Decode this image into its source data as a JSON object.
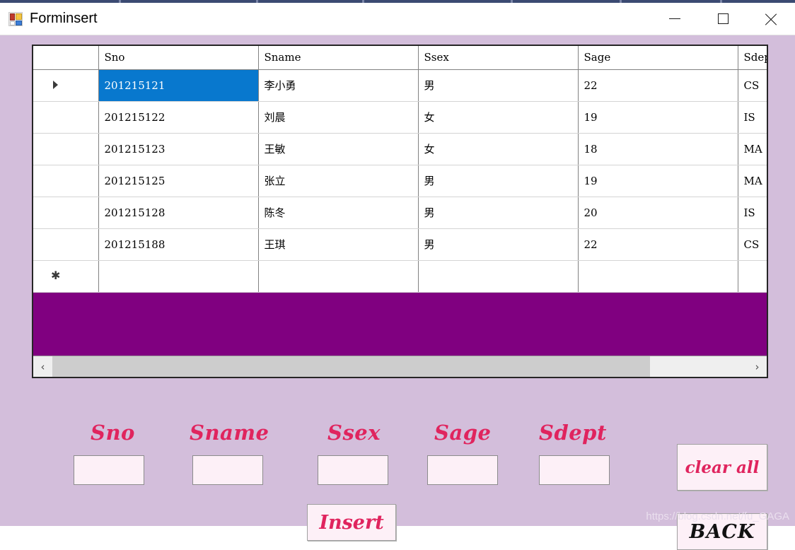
{
  "window": {
    "title": "Forminsert",
    "icon": "winforms-app-icon",
    "controls": {
      "minimize": "minimize-button",
      "maximize": "maximize-button",
      "close": "close-button"
    }
  },
  "grid": {
    "row_header_label": "",
    "columns": [
      "Sno",
      "Sname",
      "Ssex",
      "Sage",
      "Sdep"
    ],
    "rows": [
      {
        "marker": "▶",
        "sno": "201215121",
        "sname": "李小勇",
        "ssex": "男",
        "sage": "22",
        "sdept": "CS",
        "selected": true
      },
      {
        "marker": "",
        "sno": "201215122",
        "sname": "刘晨",
        "ssex": "女",
        "sage": "19",
        "sdept": "IS",
        "selected": false
      },
      {
        "marker": "",
        "sno": "201215123",
        "sname": "王敏",
        "ssex": "女",
        "sage": "18",
        "sdept": "MA",
        "selected": false
      },
      {
        "marker": "",
        "sno": "201215125",
        "sname": "张立",
        "ssex": "男",
        "sage": "19",
        "sdept": "MA",
        "selected": false
      },
      {
        "marker": "",
        "sno": "201215128",
        "sname": "陈冬",
        "ssex": "男",
        "sage": "20",
        "sdept": "IS",
        "selected": false
      },
      {
        "marker": "",
        "sno": "201215188",
        "sname": "王琪",
        "ssex": "男",
        "sage": "22",
        "sdept": "CS",
        "selected": false
      },
      {
        "marker": "*",
        "sno": "",
        "sname": "",
        "ssex": "",
        "sage": "",
        "sdept": "",
        "selected": false
      }
    ],
    "background_color": "#800080",
    "selection_color": "#0878ce",
    "scrollbar": {
      "left_arrow": "‹",
      "right_arrow": "›",
      "thumb_percent": "86"
    }
  },
  "fields": [
    {
      "label": "Sno",
      "value": "",
      "placeholder": ""
    },
    {
      "label": "Sname",
      "value": "",
      "placeholder": ""
    },
    {
      "label": "Ssex",
      "value": "",
      "placeholder": ""
    },
    {
      "label": "Sage",
      "value": "",
      "placeholder": ""
    },
    {
      "label": "Sdept",
      "value": "",
      "placeholder": ""
    }
  ],
  "buttons": {
    "insert": "Insert",
    "clear_all": "clear all",
    "back": "BACK"
  },
  "watermark": "https://blog.csdn.net/fu_GAGA",
  "colors": {
    "form_background": "#d3bedb",
    "grid_background": "#800080",
    "accent_text": "#e0245e",
    "input_background": "#fdf0f7",
    "selection": "#0878ce"
  }
}
